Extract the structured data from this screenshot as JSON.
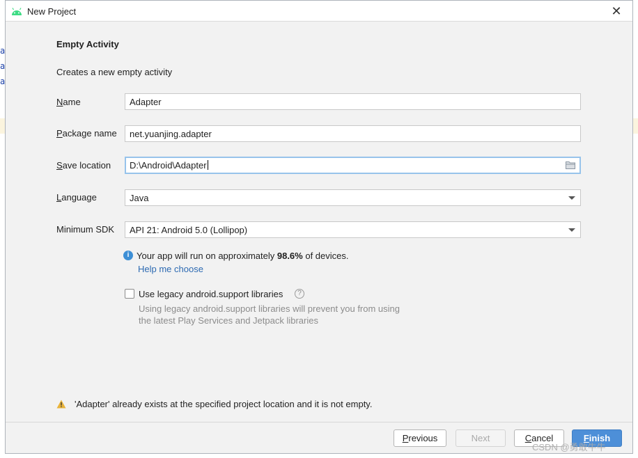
{
  "background": {
    "glyphs": [
      "a",
      "a",
      "a"
    ]
  },
  "dialog": {
    "title": "New Project",
    "template_name": "Empty Activity",
    "template_description": "Creates a new empty activity"
  },
  "form": {
    "name": {
      "label_initial": "N",
      "label_rest": "ame",
      "value": "Adapter"
    },
    "package": {
      "label_initial": "P",
      "label_rest": "ackage name",
      "value": "net.yuanjing.adapter"
    },
    "save_location": {
      "label_initial": "S",
      "label_rest": "ave location",
      "value": "D:\\Android\\Adapter"
    },
    "language": {
      "label_initial": "L",
      "label_rest": "anguage",
      "value": "Java"
    },
    "min_sdk": {
      "label": "Minimum SDK",
      "value": "API 21: Android 5.0 (Lollipop)"
    }
  },
  "info": {
    "before": "Your app will run on approximately ",
    "percent": "98.6%",
    "after": " of devices.",
    "help_link": "Help me choose"
  },
  "legacy": {
    "checked": false,
    "label": "Use legacy android.support libraries",
    "hint_line1": "Using legacy android.support libraries will prevent you from using",
    "hint_line2": "the latest Play Services and Jetpack libraries"
  },
  "warning": "'Adapter' already exists at the specified project location and it is not empty.",
  "buttons": {
    "previous_initial": "P",
    "previous_rest": "revious",
    "next": "Next",
    "cancel_initial": "C",
    "cancel_rest": "ancel",
    "finish_initial": "F",
    "finish_rest": "inish"
  },
  "watermark": "CSDN @勇敢牛牛",
  "colors": {
    "accent": "#4d8fd8",
    "link": "#2d6ab2",
    "focus": "#97c3eb",
    "warning": "#e8b33a"
  }
}
